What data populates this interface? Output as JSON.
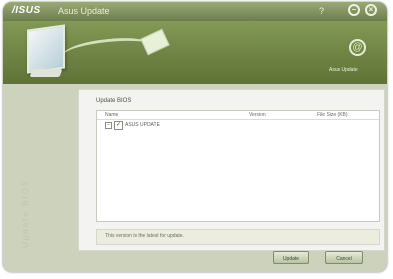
{
  "app": {
    "logo": "/ISUS",
    "title": "Asus Update"
  },
  "titlebar": {
    "minimize": "–",
    "close": "×"
  },
  "banner": {
    "support_label": "Asus Update"
  },
  "sidebar": {
    "vertical_text": "Update BIOS"
  },
  "panel": {
    "heading": "Update BIOS",
    "columns": [
      "Name",
      "Version",
      "File Size (KB)"
    ],
    "rows": [
      {
        "label": "ASUS UPDATE",
        "expanded": true,
        "checked": true
      }
    ],
    "status_text": "This version is the latest for update."
  },
  "buttons": {
    "update": "Update",
    "cancel": "Cancel"
  },
  "icons": {
    "minimize": "minimize-icon",
    "close": "close-icon",
    "support": "support-icon",
    "monitor": "monitor-icon",
    "cd": "cd-icon"
  }
}
